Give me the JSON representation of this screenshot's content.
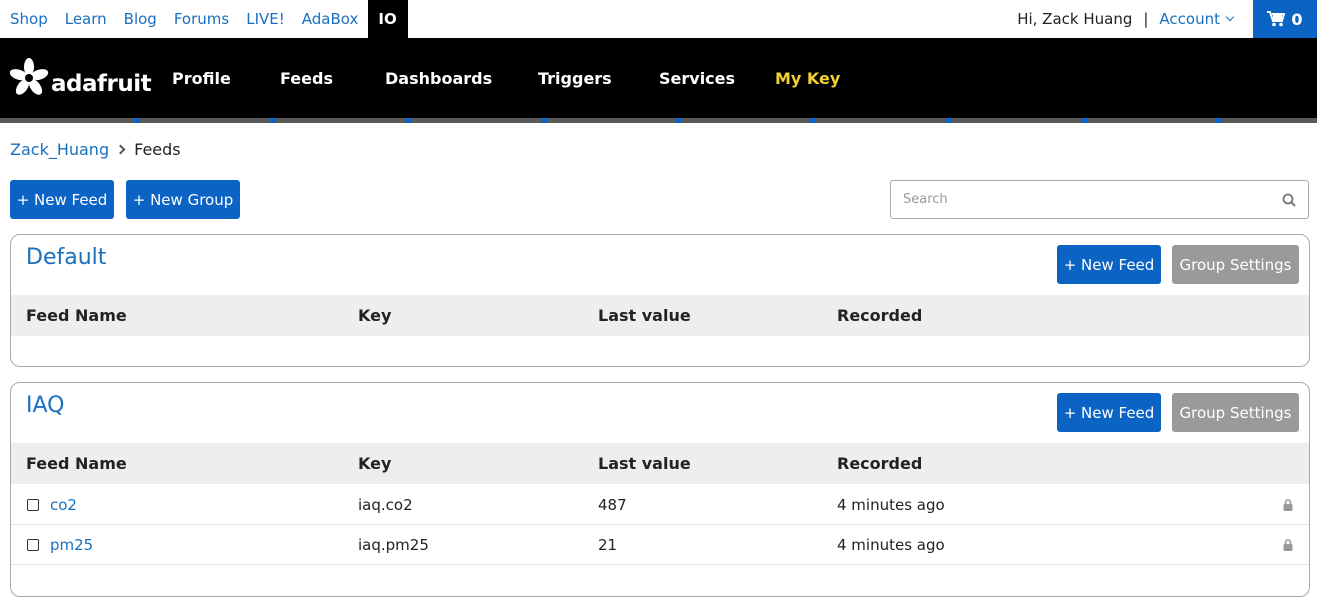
{
  "topbar": {
    "links": [
      "Shop",
      "Learn",
      "Blog",
      "Forums",
      "LIVE!",
      "AdaBox"
    ],
    "active_link": "IO",
    "greeting": "Hi, Zack Huang",
    "separator": "|",
    "account": "Account",
    "cart_count": "0"
  },
  "nav": {
    "logo_text": "adafruit",
    "items": [
      "Profile",
      "Feeds",
      "Dashboards",
      "Triggers",
      "Services"
    ],
    "key_item": "My Key"
  },
  "breadcrumb": {
    "user": "Zack_Huang",
    "current": "Feeds"
  },
  "actions": {
    "new_feed": "+ New Feed",
    "new_group": "+ New Group"
  },
  "search": {
    "placeholder": "Search"
  },
  "columns": {
    "name": "Feed Name",
    "key": "Key",
    "last_value": "Last value",
    "recorded": "Recorded"
  },
  "groups": [
    {
      "title": "Default",
      "new_feed": "+ New Feed",
      "settings": "Group Settings",
      "feeds": []
    },
    {
      "title": "IAQ",
      "new_feed": "+ New Feed",
      "settings": "Group Settings",
      "feeds": [
        {
          "name": "co2",
          "key": "iaq.co2",
          "last_value": "487",
          "recorded": "4 minutes ago"
        },
        {
          "name": "pm25",
          "key": "iaq.pm25",
          "last_value": "21",
          "recorded": "4 minutes ago"
        }
      ]
    }
  ],
  "colors": {
    "link": "#1a6fbf",
    "primary_button": "#0b63c4",
    "secondary_button": "#9a9a9a",
    "my_key": "#f0d02e"
  },
  "icons": {
    "cart": "cart-icon",
    "search": "search-icon",
    "lock": "lock-icon",
    "logo": "adafruit-star-icon"
  }
}
